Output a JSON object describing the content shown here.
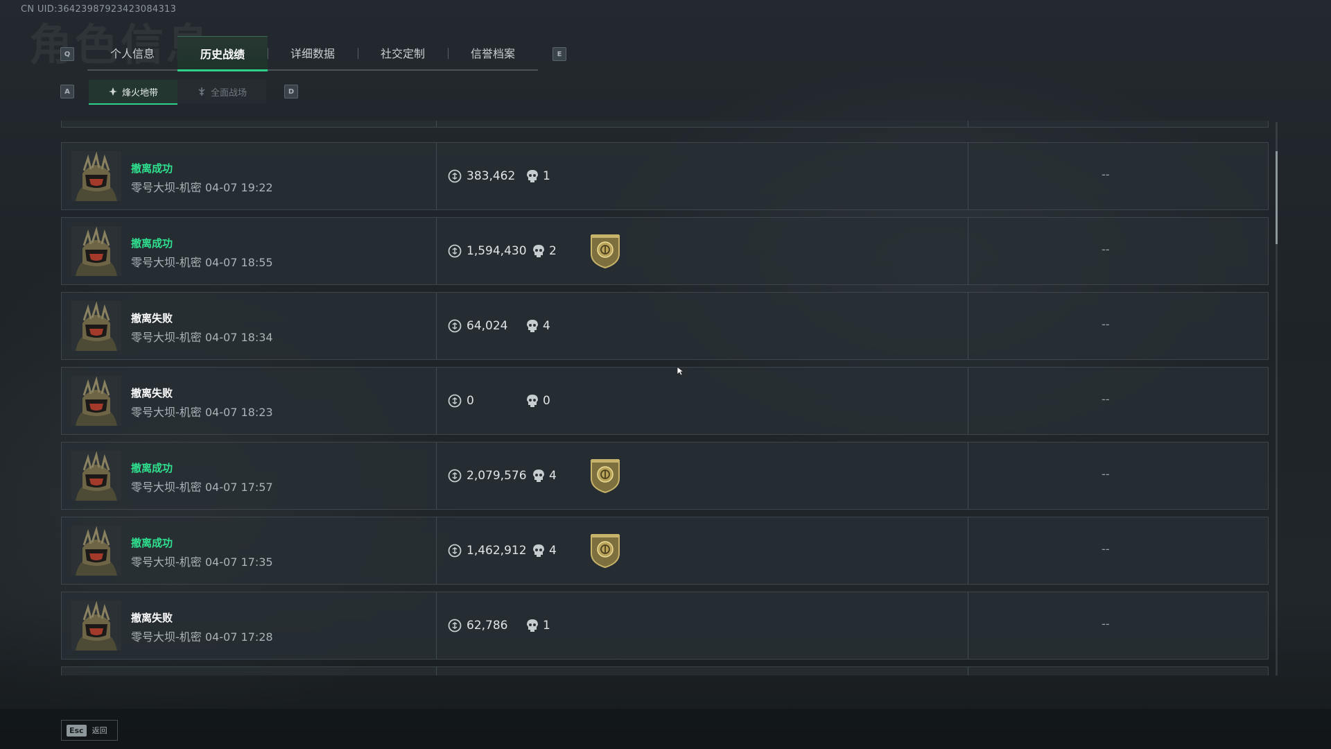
{
  "header": {
    "uid": "CN UID:36423987923423084313",
    "watermark": "角色信息"
  },
  "tabs": {
    "left_key": "Q",
    "right_key": "E",
    "items": [
      {
        "label": "个人信息",
        "active": false
      },
      {
        "label": "历史战绩",
        "active": true
      },
      {
        "label": "详细数据",
        "active": false
      },
      {
        "label": "社交定制",
        "active": false
      },
      {
        "label": "信誉档案",
        "active": false
      }
    ]
  },
  "subtabs": {
    "left_key": "A",
    "right_key": "D",
    "items": [
      {
        "label": "烽火地带",
        "icon": "flame-mode-icon",
        "active": true
      },
      {
        "label": "全面战场",
        "icon": "battlefield-mode-icon",
        "active": false
      }
    ]
  },
  "matches": [
    {
      "status": "撤离成功",
      "success": true,
      "map": "零号大坝-机密",
      "time": "04-07 19:22",
      "value": "383,462",
      "kills": "1",
      "badge": false,
      "extra": "--"
    },
    {
      "status": "撤离成功",
      "success": true,
      "map": "零号大坝-机密",
      "time": "04-07 18:55",
      "value": "1,594,430",
      "kills": "2",
      "badge": true,
      "extra": "--"
    },
    {
      "status": "撤离失败",
      "success": false,
      "map": "零号大坝-机密",
      "time": "04-07 18:34",
      "value": "64,024",
      "kills": "4",
      "badge": false,
      "extra": "--"
    },
    {
      "status": "撤离失败",
      "success": false,
      "map": "零号大坝-机密",
      "time": "04-07 18:23",
      "value": "0",
      "kills": "0",
      "badge": false,
      "extra": "--"
    },
    {
      "status": "撤离成功",
      "success": true,
      "map": "零号大坝-机密",
      "time": "04-07 17:57",
      "value": "2,079,576",
      "kills": "4",
      "badge": true,
      "extra": "--"
    },
    {
      "status": "撤离成功",
      "success": true,
      "map": "零号大坝-机密",
      "time": "04-07 17:35",
      "value": "1,462,912",
      "kills": "4",
      "badge": true,
      "extra": "--"
    },
    {
      "status": "撤离失败",
      "success": false,
      "map": "零号大坝-机密",
      "time": "04-07 17:28",
      "value": "62,786",
      "kills": "1",
      "badge": false,
      "extra": "--"
    }
  ],
  "footer": {
    "esc_key": "Esc",
    "back_label": "返回"
  },
  "colors": {
    "accent": "#2fd08a",
    "success_text": "#2fe08f",
    "badge_gold": "#b9a45a"
  }
}
